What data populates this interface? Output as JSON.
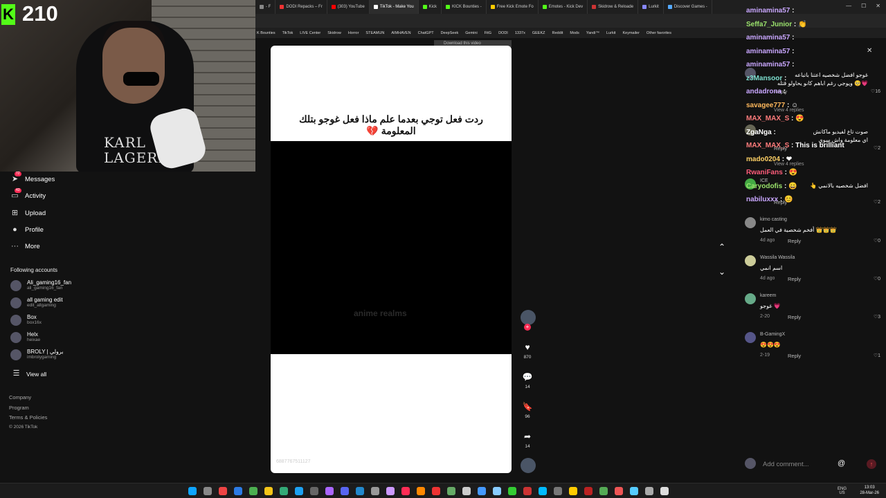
{
  "stream": {
    "view_count": "210",
    "shirt_text": "KARL\nLAGERFEL"
  },
  "browser": {
    "tabs": [
      {
        "label": "- F",
        "color": "#888"
      },
      {
        "label": "DODI Repacks – Fr",
        "color": "#e33"
      },
      {
        "label": "(303) YouTube",
        "color": "#f00"
      },
      {
        "label": "TikTok - Make You",
        "color": "#fff",
        "active": true
      },
      {
        "label": "Kick",
        "color": "#53fc18"
      },
      {
        "label": "KICK Bounties - ",
        "color": "#53fc18"
      },
      {
        "label": "Free Kick Emote Fo",
        "color": "#fc0"
      },
      {
        "label": "Emotes - Kick Dev",
        "color": "#53fc18"
      },
      {
        "label": "Skidrow & Reloade",
        "color": "#c33"
      },
      {
        "label": "Lurkit",
        "color": "#88f"
      },
      {
        "label": "Discover Games - ",
        "color": "#5af"
      }
    ],
    "bookmarks": [
      "K Bounties",
      "TikTok",
      "LIVE Center",
      "Skidrow",
      "Horror",
      "STEAMUN",
      "AIMHAVEN",
      "ChatGPT",
      "DeepSeek",
      "Gemini",
      "FitG",
      "DODI",
      "1337x",
      "GEEKZ",
      "Reddit",
      "Mods",
      "Yandi™",
      "Lurkit",
      "Keymailer",
      "Other favorites"
    ],
    "download_bar": "Download this video"
  },
  "sidebar": {
    "items": [
      {
        "label": "Messages",
        "icon": "send-icon",
        "badge": "72"
      },
      {
        "label": "Activity",
        "icon": "inbox-icon",
        "badge": "43"
      },
      {
        "label": "Upload",
        "icon": "plus-square-icon",
        "badge": ""
      },
      {
        "label": "Profile",
        "icon": "avatar-icon",
        "badge": ""
      },
      {
        "label": "More",
        "icon": "ellipsis-icon",
        "badge": ""
      }
    ],
    "following_title": "Following accounts",
    "accounts": [
      {
        "name": "Ali_gaming16_fan",
        "handle": "ali_gaming16_fan"
      },
      {
        "name": "all gaming edit",
        "handle": "edit_allgaming"
      },
      {
        "name": "Box",
        "handle": "box16x"
      },
      {
        "name": "Helx",
        "handle": "heixae"
      },
      {
        "name": "BROLY | برولي",
        "handle": "imbrolygaming"
      }
    ],
    "view_all": "View all",
    "footer": [
      "Company",
      "Program",
      "Terms & Policies",
      "© 2026 TikTok"
    ]
  },
  "video": {
    "caption": "ردت فعل توجي بعدما علم ماذا فعل غوجو بتلك المعلومة 💔",
    "watermark": "anime realms",
    "id_text": "6887767511127"
  },
  "actions": {
    "likes": "870",
    "comments": "14",
    "saves": "96",
    "shares": "14"
  },
  "comments": [
    {
      "user": "",
      "text": "غوجو افضل شخصيه اعتنا باتباعه",
      "text2": "ويوجي رغم اباهم كانو يحاولو قتله 🥺💗",
      "date": "",
      "reply": "Reply",
      "likes": "16"
    },
    {
      "user": "",
      "text": "صوت تاع لفيديو ماكانش",
      "text2": "اي معلومة واش سوى",
      "date": "",
      "reply": "Reply",
      "likes": "2"
    },
    {
      "user": "ICE",
      "text": "افضل شخصيه بالانمي 👆",
      "text2": "",
      "date": "",
      "reply": "Reply",
      "likes": "2"
    },
    {
      "user": "kimo casting",
      "text": "أفخم شخصية في العمل 👑👑👑",
      "text2": "",
      "date": "4d ago",
      "reply": "Reply",
      "likes": "0"
    },
    {
      "user": "Wassila Wassila",
      "text": "اسم انمي",
      "text2": "",
      "date": "4d ago",
      "reply": "Reply",
      "likes": "0"
    },
    {
      "user": "kareem",
      "text": "غوجو 💗",
      "text2": "",
      "date": "2-20",
      "reply": "Reply",
      "likes": "3"
    },
    {
      "user": "B-GamingX",
      "text": "😍😍😍",
      "text2": "",
      "date": "2-19",
      "reply": "Reply",
      "likes": "1"
    }
  ],
  "view_replies": [
    "View 4 replies",
    "View 4 replies"
  ],
  "chat": [
    {
      "user": "aminamina57",
      "msg": ":",
      "color": "#c9a7ff"
    },
    {
      "user": "Seffa7_Junior",
      "msg": ": 👏",
      "color": "#9be36c"
    },
    {
      "user": "aminamina57",
      "msg": ":",
      "color": "#c9a7ff"
    },
    {
      "user": "aminamina57",
      "msg": ":",
      "color": "#c9a7ff"
    },
    {
      "user": "aminamina57",
      "msg": ":",
      "color": "#c9a7ff"
    },
    {
      "user": "z3Mansoor",
      "msg": ":",
      "color": "#7ee0d0"
    },
    {
      "user": "andadrona",
      "msg": ":",
      "color": "#c9a7ff"
    },
    {
      "user": "savagee777",
      "msg": ": ☺",
      "color": "#ffb85c"
    },
    {
      "user": "MAX_MAX_S",
      "msg": ": 😍",
      "color": "#ff7b7b"
    },
    {
      "user": "ZgaNga",
      "msg": ":",
      "color": "#fff"
    },
    {
      "user": "MAX_MAX_S",
      "msg": ": This is brilliant",
      "color": "#ff7b7b"
    },
    {
      "user": "mado0204",
      "msg": ": ❤",
      "color": "#ffd166"
    },
    {
      "user": "RwaniFans",
      "msg": ": 😍",
      "color": "#ff5c7a"
    },
    {
      "user": "Caryodofis",
      "msg": ": 😄",
      "color": "#9be36c"
    },
    {
      "user": "nabiluxxx",
      "msg": ": 😊",
      "color": "#c9a7ff"
    }
  ],
  "add_comment": "Add comment...",
  "taskbar": {
    "time": "13:03",
    "date": "28-Mar-26",
    "lang": "ENG",
    "region": "US"
  }
}
